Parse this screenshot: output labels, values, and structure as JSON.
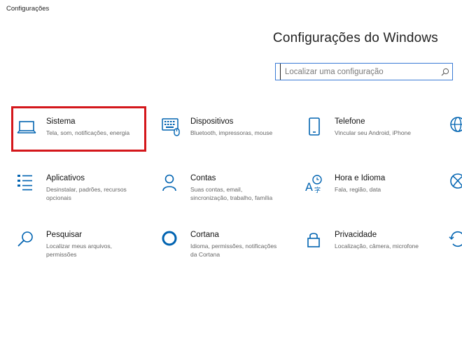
{
  "window": {
    "title": "Configurações"
  },
  "header": {
    "title": "Configurações do Windows"
  },
  "search": {
    "placeholder": "Localizar uma configuração"
  },
  "tiles": [
    {
      "title": "Sistema",
      "desc": "Tela, som, notificações, energia",
      "icon": "laptop-icon"
    },
    {
      "title": "Dispositivos",
      "desc": "Bluetooth, impressoras, mouse",
      "icon": "keyboard-icon"
    },
    {
      "title": "Telefone",
      "desc": "Vincular seu Android, iPhone",
      "icon": "phone-icon"
    },
    {
      "title": "Aplicativos",
      "desc": "Desinstalar, padrões, recursos opcionais",
      "icon": "apps-list-icon"
    },
    {
      "title": "Contas",
      "desc": "Suas contas, email, sincronização, trabalho, família",
      "icon": "person-icon"
    },
    {
      "title": "Hora e Idioma",
      "desc": "Fala, região, data",
      "icon": "language-time-icon"
    },
    {
      "title": "Pesquisar",
      "desc": "Localizar meus arquivos, permissões",
      "icon": "search-icon"
    },
    {
      "title": "Cortana",
      "desc": "Idioma, permissões, notificações da Cortana",
      "icon": "cortana-ring-icon"
    },
    {
      "title": "Privacidade",
      "desc": "Localização, câmera, microfone",
      "icon": "lock-icon"
    }
  ],
  "colors": {
    "accent": "#0063b1",
    "highlight": "#d4171b",
    "search_border": "#3a7bd5"
  }
}
